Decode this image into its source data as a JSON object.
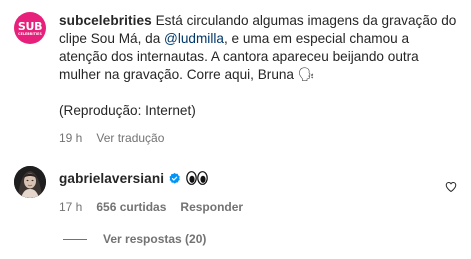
{
  "comment1": {
    "avatar_text_big": "SUB",
    "avatar_text_small": "CELEBRITIES",
    "username": "subcelebrities",
    "text_part1": "Está circulando algumas imagens da gravação do clipe Sou Má, da ",
    "mention": "@ludmilla",
    "text_part2": ", e uma em especial chamou a atenção dos internautas. A cantora apareceu beijando outra mulher na gravação. Corre aqui, Bruna 🗣",
    "text_part3": "\n\n(Reprodução: Internet)",
    "time": "19 h",
    "translate_label": "Ver tradução"
  },
  "comment2": {
    "username": "gabrielaversiani",
    "emoji": "👀",
    "time": "17 h",
    "likes": "656 curtidas",
    "reply_label": "Responder"
  },
  "replies": {
    "label": "Ver respostas (20)"
  },
  "colors": {
    "brand_pink": "#e7217b",
    "verified_blue": "#0095f6",
    "mention": "#00376b",
    "meta_gray": "#737373"
  }
}
